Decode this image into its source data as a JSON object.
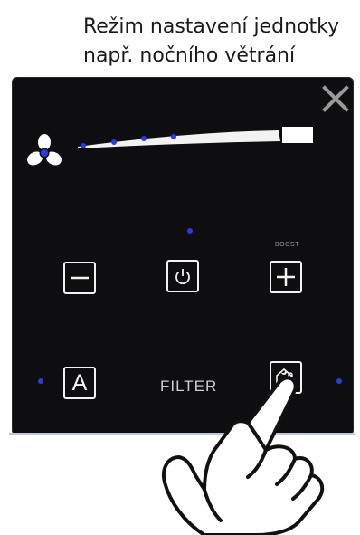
{
  "caption": {
    "line1": "Režim nastavení jednotky",
    "line2": "např. nočního větrání"
  },
  "panel": {
    "close_icon": "close-x-icon",
    "fan_icon": "fan-icon",
    "speed_bar_icon": "fan-speed-bar",
    "buttons": {
      "minus": {
        "icon": "minus-icon"
      },
      "power": {
        "icon": "power-icon"
      },
      "plus": {
        "icon": "plus-icon",
        "label": "BOOST"
      },
      "auto": {
        "label": "A"
      },
      "mode": {
        "icon": "night-mode-thermometer-icon"
      }
    },
    "filter_label": "FILTER",
    "indicator_color": "#2a3be0"
  },
  "overlay": {
    "hand_icon": "pointing-hand-icon"
  },
  "colors": {
    "panel_bg": "#0e0e10",
    "icon_color": "#f2f2f2",
    "indicator": "#2a3be0"
  }
}
